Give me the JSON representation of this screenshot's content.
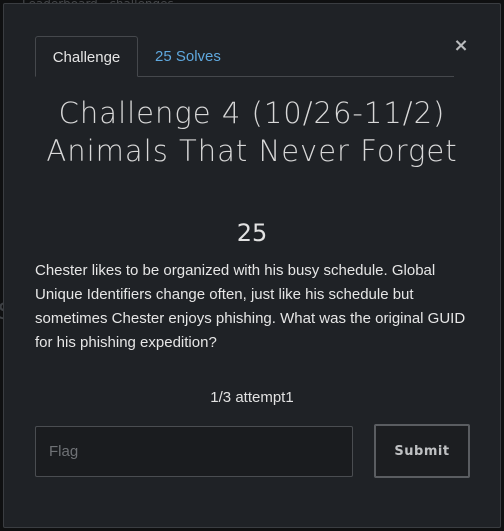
{
  "background": {
    "topbar_text": "Leaderboard · challenges",
    "left_glyph": "S"
  },
  "modal": {
    "close_label": "×",
    "tabs": [
      {
        "label": "Challenge",
        "active": true
      },
      {
        "label": "25 Solves",
        "active": false
      }
    ],
    "title": "Challenge 4 (10/26-11/2) Animals That Never Forget",
    "points": "25",
    "description": "Chester likes to be organized with his busy schedule. Global Unique Identifiers change often, just like his schedule but sometimes Chester enjoys phishing. What was the original GUID for his phishing expedition?",
    "attempts": "1/3 attempt1",
    "flag_input": {
      "placeholder": "Flag",
      "value": ""
    },
    "submit_label": "Submit"
  },
  "colors": {
    "modal_bg": "#1f2226",
    "tab_solves": "#5fa8de",
    "text": "#e6e6e6"
  }
}
